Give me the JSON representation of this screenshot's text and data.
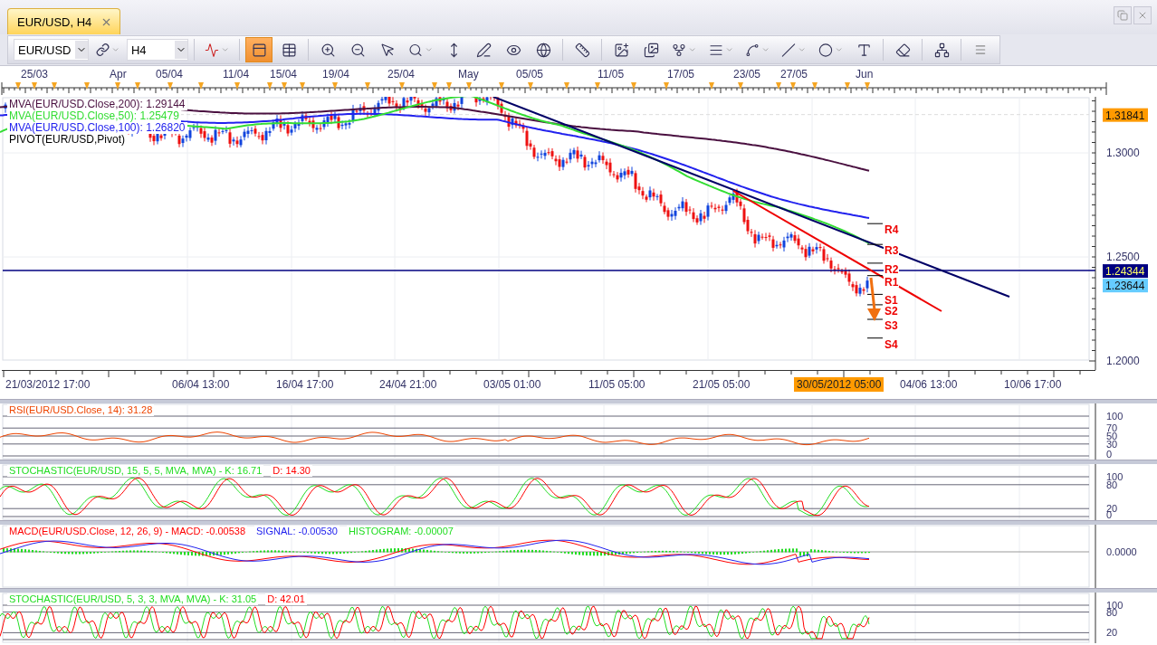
{
  "tab": {
    "title": "EUR/USD, H4",
    "selected": true
  },
  "toolbar": {
    "symbol": "EUR/USD",
    "timeframe": "H4",
    "toggles": [
      {
        "selected": true
      },
      {
        "selected": false
      }
    ]
  },
  "date_ruler": [
    {
      "label": "25/03"
    },
    {
      "label": "Apr"
    },
    {
      "label": "05/04"
    },
    {
      "label": "11/04"
    },
    {
      "label": "15/04"
    },
    {
      "label": "19/04"
    },
    {
      "label": "25/04"
    },
    {
      "label": "May"
    },
    {
      "label": "05/05"
    },
    {
      "label": "11/05"
    },
    {
      "label": "17/05"
    },
    {
      "label": "23/05"
    },
    {
      "label": "27/05"
    },
    {
      "label": "Jun"
    }
  ],
  "price_chart": {
    "studies": [
      {
        "text": "MVA(EUR/USD.Close,200): 1.29144",
        "color": "#4a1040"
      },
      {
        "text": "MVA(EUR/USD.Close,50): 1.25479",
        "color": "#33dd33"
      },
      {
        "text": "MVA(EUR/USD.Close,100): 1.26820",
        "color": "#2222ee"
      },
      {
        "text": "PIVOT(EUR/USD,Pivot)",
        "color": "#000000"
      }
    ],
    "pivots": [
      {
        "label": "R4"
      },
      {
        "label": "R3"
      },
      {
        "label": "R2"
      },
      {
        "label": "R1"
      },
      {
        "label": "S1"
      },
      {
        "label": "S2"
      },
      {
        "label": "S3"
      },
      {
        "label": "S4"
      }
    ],
    "axis_ticks": [
      "1.3000",
      "1.2500",
      "1.2000"
    ],
    "price_labels": [
      {
        "text": "1.31841",
        "color": "#ff9a00"
      },
      {
        "text": "1.24344",
        "color": "#000080"
      },
      {
        "text": "1.23644",
        "color": "#66ccff"
      }
    ]
  },
  "time_axis": [
    {
      "label": "21/03/2012 17:00",
      "highlighted": false
    },
    {
      "label": "06/04 13:00",
      "highlighted": false
    },
    {
      "label": "16/04 17:00",
      "highlighted": false
    },
    {
      "label": "24/04 21:00",
      "highlighted": false
    },
    {
      "label": "03/05 01:00",
      "highlighted": false
    },
    {
      "label": "11/05 05:00",
      "highlighted": false
    },
    {
      "label": "21/05 05:00",
      "highlighted": false
    },
    {
      "label": "30/05/2012 05:00",
      "highlighted": true
    },
    {
      "label": "04/06 13:00",
      "highlighted": false
    },
    {
      "label": "10/06 17:00",
      "highlighted": false
    }
  ],
  "indicators": [
    {
      "kind": "rsi",
      "legend": [
        {
          "text": "RSI(EUR/USD.Close, 14): 31.28",
          "color": "#ee4400"
        }
      ],
      "axis": [
        "100",
        "70",
        "50",
        "30",
        "0"
      ]
    },
    {
      "kind": "stochastic",
      "legend": [
        {
          "text": "STOCHASTIC(EUR/USD, 15, 5, 5, MVA, MVA) -  K: 16.71",
          "color": "#22dd22"
        },
        {
          "text": "D: 14.30",
          "color": "#ff0000"
        }
      ],
      "axis": [
        "100",
        "80",
        "20",
        "0"
      ]
    },
    {
      "kind": "macd",
      "legend": [
        {
          "text": "MACD(EUR/USD.Close, 12, 26, 9) -  MACD: -0.00538",
          "color": "#ff0000"
        },
        {
          "text": "SIGNAL: -0.00530",
          "color": "#2222ee"
        },
        {
          "text": "HISTOGRAM: -0.00007",
          "color": "#22dd22"
        }
      ],
      "axis": [
        "0.0000"
      ]
    },
    {
      "kind": "stochastic",
      "legend": [
        {
          "text": "STOCHASTIC(EUR/USD, 5, 3, 3, MVA, MVA) -  K: 31.05",
          "color": "#22dd22"
        },
        {
          "text": "D: 42.01",
          "color": "#ff0000"
        }
      ],
      "axis": [
        "100",
        "80",
        "20"
      ]
    }
  ]
}
